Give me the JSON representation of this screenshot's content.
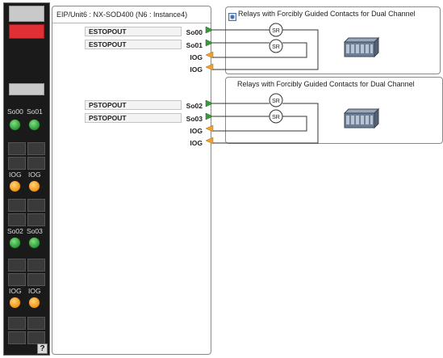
{
  "unit": {
    "title": "EIP/Unit6 : NX-SOD400 (N6 : Instance4)",
    "variables": [
      "ESTOPOUT",
      "ESTOPOUT",
      "PSTOPOUT",
      "PSTOPOUT"
    ],
    "ports": [
      "So00",
      "So01",
      "IOG",
      "IOG",
      "So02",
      "So03",
      "IOG",
      "IOG"
    ]
  },
  "relay_panels": [
    {
      "title": "Relays with Forcibly Guided Contacts for Dual Channel",
      "coil_labels": [
        "SR",
        "SR"
      ]
    },
    {
      "title": "Relays with Forcibly Guided Contacts for Dual Channel",
      "coil_labels": [
        "SR",
        "SR"
      ]
    }
  ],
  "strip": {
    "terminal_labels": [
      "So00",
      "So01",
      "IOG",
      "IOG",
      "So02",
      "So03",
      "IOG",
      "IOG"
    ],
    "help": "?"
  },
  "colors": {
    "led_green": "#2f9e3a",
    "led_orange": "#f29a1a",
    "port_out_arrow": "#3a9a3a",
    "port_in_arrow": "#f0a030",
    "header_red": "#e03035"
  }
}
